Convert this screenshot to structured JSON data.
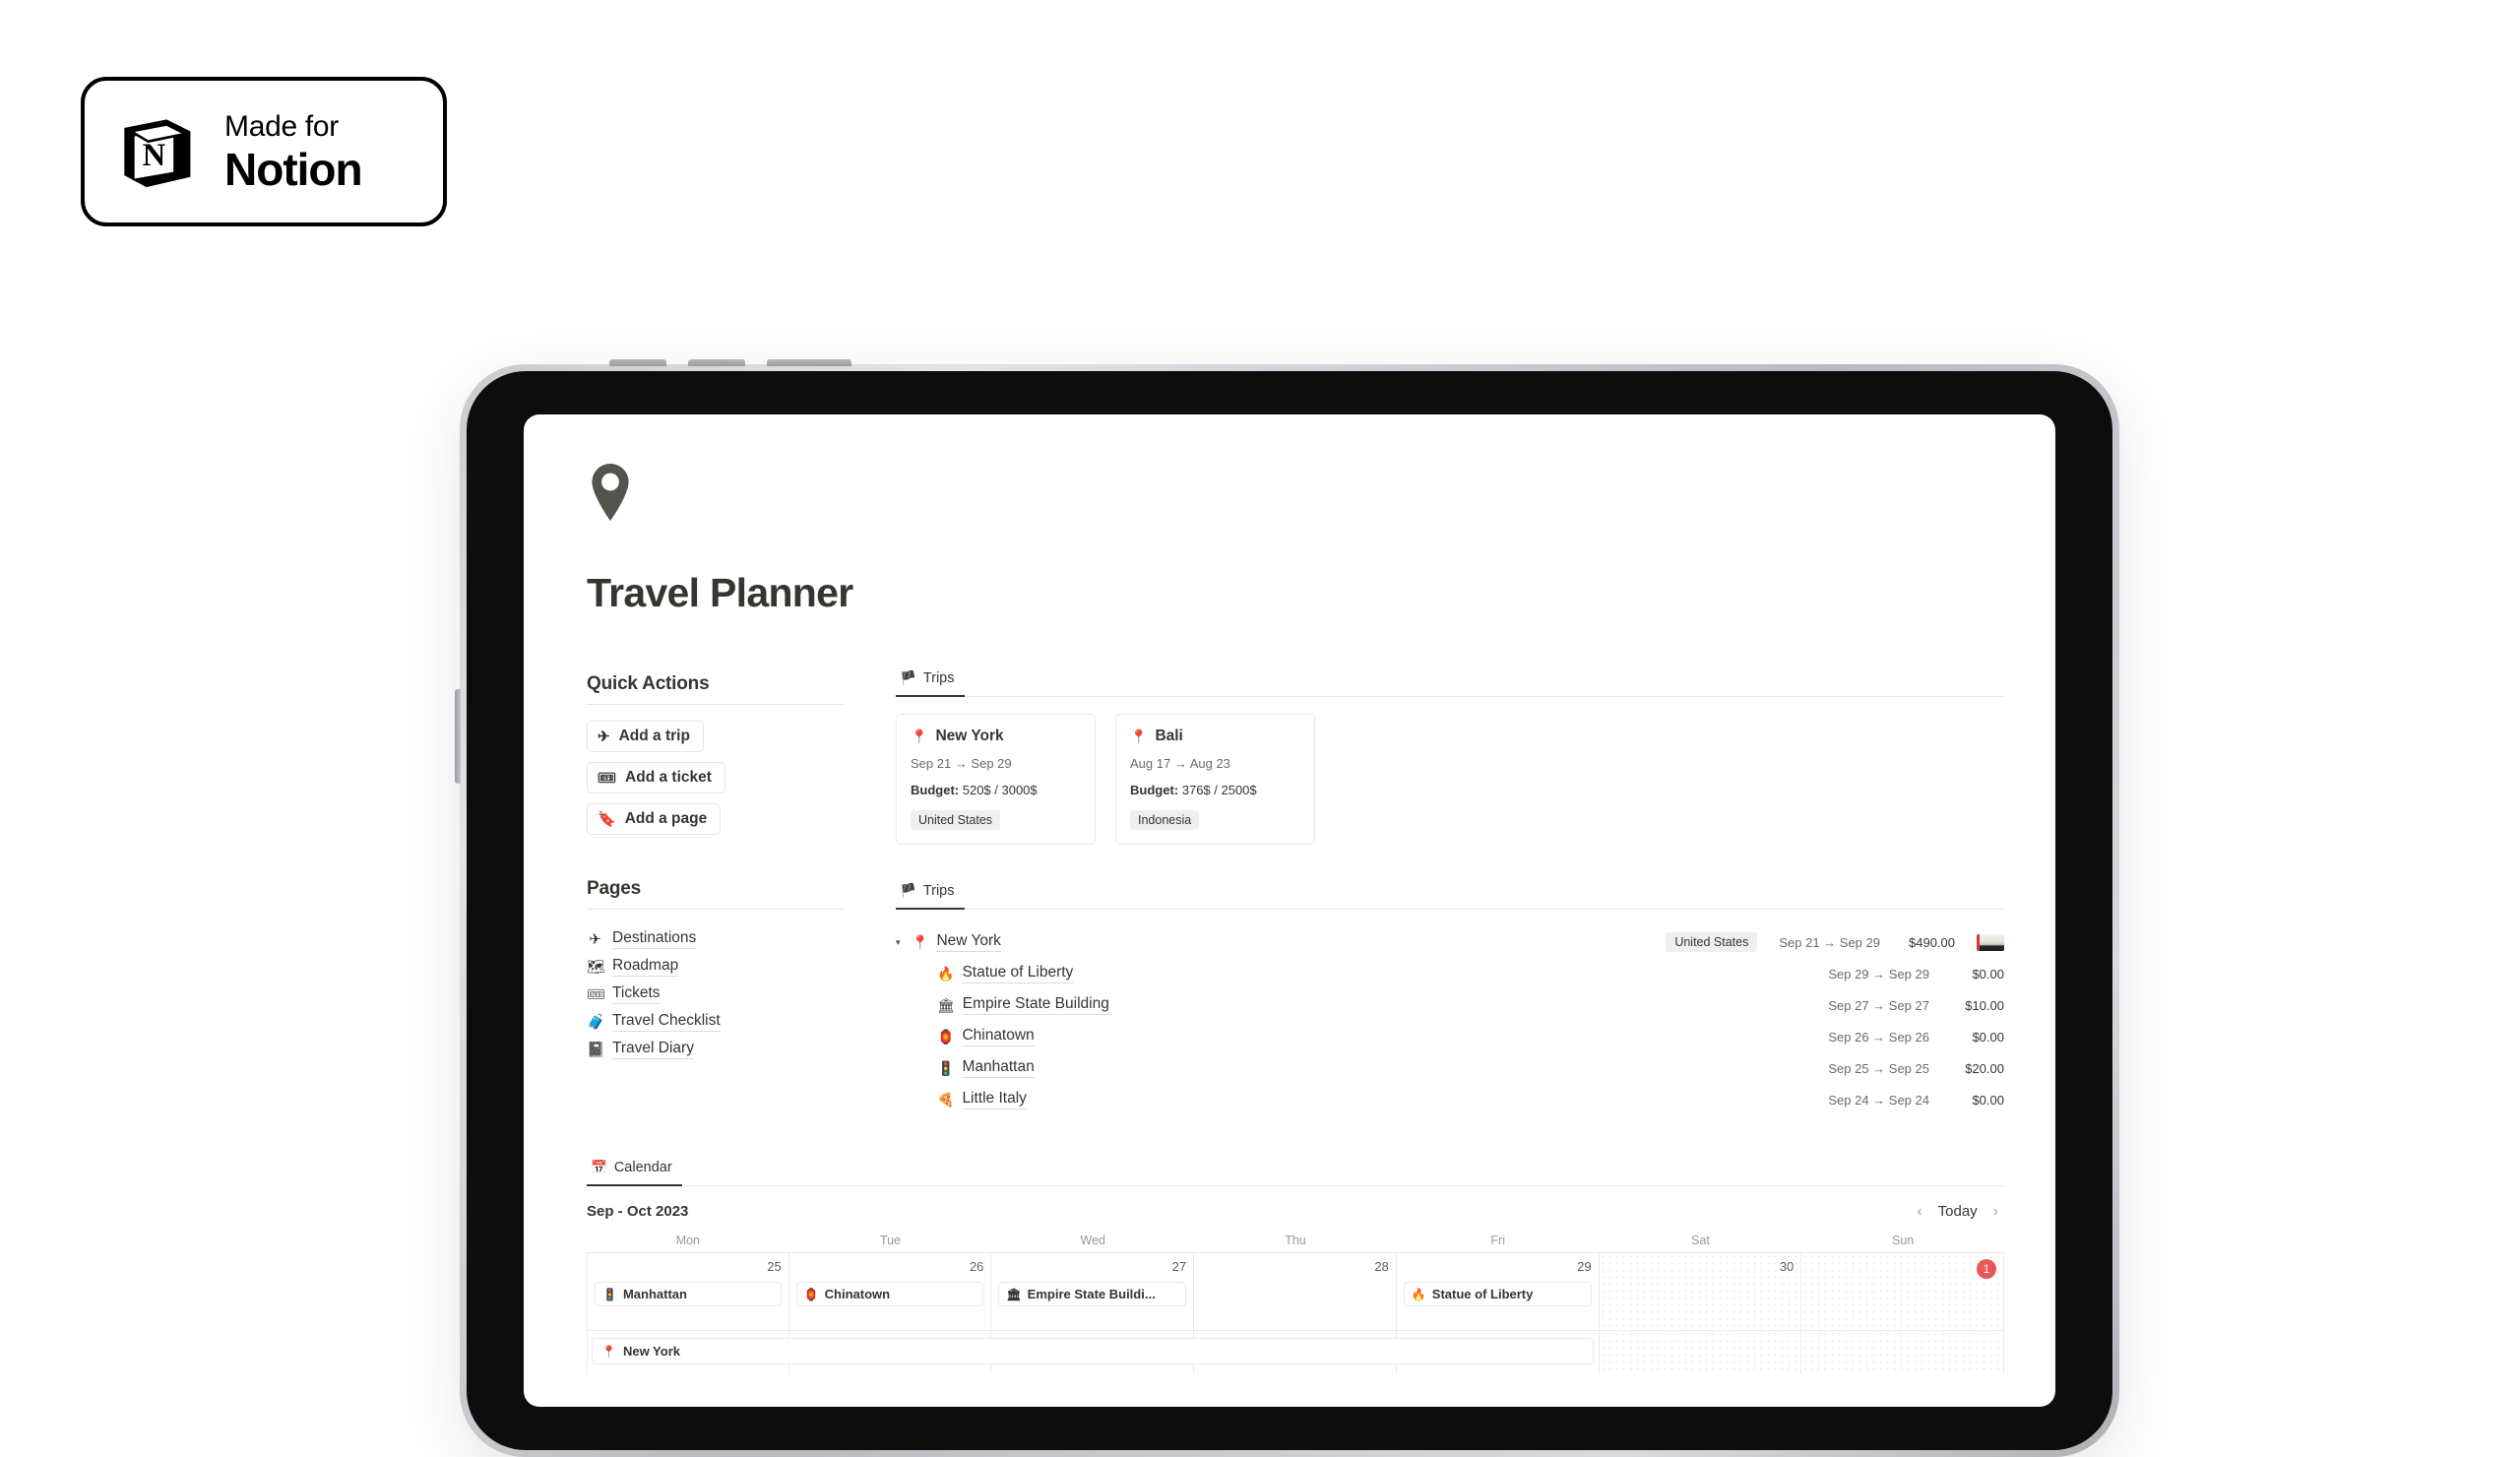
{
  "badge": {
    "made_for": "Made for",
    "product": "Notion",
    "logo_icon": "notion-cube-icon"
  },
  "page": {
    "icon": "map-pin-icon",
    "title": "Travel Planner"
  },
  "quick_actions": {
    "heading": "Quick Actions",
    "buttons": [
      {
        "icon": "airplane-icon",
        "glyph": "✈",
        "label": "Add a trip"
      },
      {
        "icon": "ticket-icon",
        "glyph": "🎟",
        "label": "Add a ticket"
      },
      {
        "icon": "bookmark-icon",
        "glyph": "🔖",
        "label": "Add a page"
      }
    ]
  },
  "pages": {
    "heading": "Pages",
    "items": [
      {
        "icon": "airplane-icon",
        "glyph": "✈",
        "label": "Destinations"
      },
      {
        "icon": "map-icon",
        "glyph": "🗺",
        "label": "Roadmap"
      },
      {
        "icon": "ticket-icon",
        "glyph": "🎟",
        "label": "Tickets"
      },
      {
        "icon": "luggage-icon",
        "glyph": "🧳",
        "label": "Travel Checklist"
      },
      {
        "icon": "notebook-icon",
        "glyph": "📓",
        "label": "Travel Diary"
      }
    ]
  },
  "trips_gallery": {
    "tab_label": "Trips",
    "tab_icon": "flag-icon",
    "tab_glyph": "🏴",
    "cards": [
      {
        "icon": "map-pin-icon",
        "glyph": "📍",
        "name": "New York",
        "dates": "Sep 21 → Sep 29",
        "budget_label": "Budget:",
        "budget_value": "520$ / 3000$",
        "country": "United States"
      },
      {
        "icon": "map-pin-icon",
        "glyph": "📍",
        "name": "Bali",
        "dates": "Aug 17 → Aug 23",
        "budget_label": "Budget:",
        "budget_value": "376$ / 2500$",
        "country": "Indonesia"
      }
    ]
  },
  "trips_list": {
    "tab_label": "Trips",
    "tab_icon": "flag-icon",
    "tab_glyph": "🏴",
    "parent": {
      "caret": "▾",
      "icon": "map-pin-icon",
      "glyph": "📍",
      "name": "New York",
      "country": "United States",
      "dates": "Sep 21 → Sep 29",
      "amount": "$490.00",
      "thumbnail": "new-york-photo-thumbnail"
    },
    "children": [
      {
        "icon": "torch-icon",
        "glyph": "🔥",
        "name": "Statue of Liberty",
        "dates": "Sep 29 → Sep 29",
        "amount": "$0.00"
      },
      {
        "icon": "classical-building-icon",
        "glyph": "🏛",
        "name": "Empire State Building",
        "dates": "Sep 27 → Sep 27",
        "amount": "$10.00"
      },
      {
        "icon": "lantern-icon",
        "glyph": "🏮",
        "name": "Chinatown",
        "dates": "Sep 26 → Sep 26",
        "amount": "$0.00"
      },
      {
        "icon": "traffic-light-icon",
        "glyph": "🚦",
        "name": "Manhattan",
        "dates": "Sep 25 → Sep 25",
        "amount": "$20.00"
      },
      {
        "icon": "pizza-icon",
        "glyph": "🍕",
        "name": "Little Italy",
        "dates": "Sep 24 → Sep 24",
        "amount": "$0.00"
      }
    ]
  },
  "calendar": {
    "tab_label": "Calendar",
    "tab_icon": "calendar-icon",
    "tab_glyph": "📅",
    "month_label": "Sep - Oct 2023",
    "nav": {
      "prev_icon": "chevron-left-icon",
      "prev_glyph": "‹",
      "today_label": "Today",
      "next_icon": "chevron-right-icon",
      "next_glyph": "›"
    },
    "day_headers": [
      "Mon",
      "Tue",
      "Wed",
      "Thu",
      "Fri",
      "Sat",
      "Sun"
    ],
    "days": [
      {
        "num": "25",
        "dim": false,
        "today": false,
        "event": {
          "icon": "traffic-light-icon",
          "glyph": "🚦",
          "label": "Manhattan"
        }
      },
      {
        "num": "26",
        "dim": false,
        "today": false,
        "event": {
          "icon": "lantern-icon",
          "glyph": "🏮",
          "label": "Chinatown"
        }
      },
      {
        "num": "27",
        "dim": false,
        "today": false,
        "event": {
          "icon": "classical-building-icon",
          "glyph": "🏛",
          "label": "Empire State Buildi..."
        }
      },
      {
        "num": "28",
        "dim": false,
        "today": false,
        "event": null
      },
      {
        "num": "29",
        "dim": false,
        "today": false,
        "event": {
          "icon": "torch-icon",
          "glyph": "🔥",
          "label": "Statue of Liberty"
        }
      },
      {
        "num": "30",
        "dim": true,
        "today": false,
        "event": null
      },
      {
        "num": "1",
        "dim": true,
        "today": true,
        "event": null
      }
    ],
    "span_event": {
      "icon": "map-pin-icon",
      "glyph": "📍",
      "label": "New York"
    }
  },
  "colors": {
    "text": "#37352f",
    "muted": "#6b6a65",
    "border": "#eceae6",
    "tag_bg": "#f0efed",
    "today_badge": "#eb5757"
  }
}
